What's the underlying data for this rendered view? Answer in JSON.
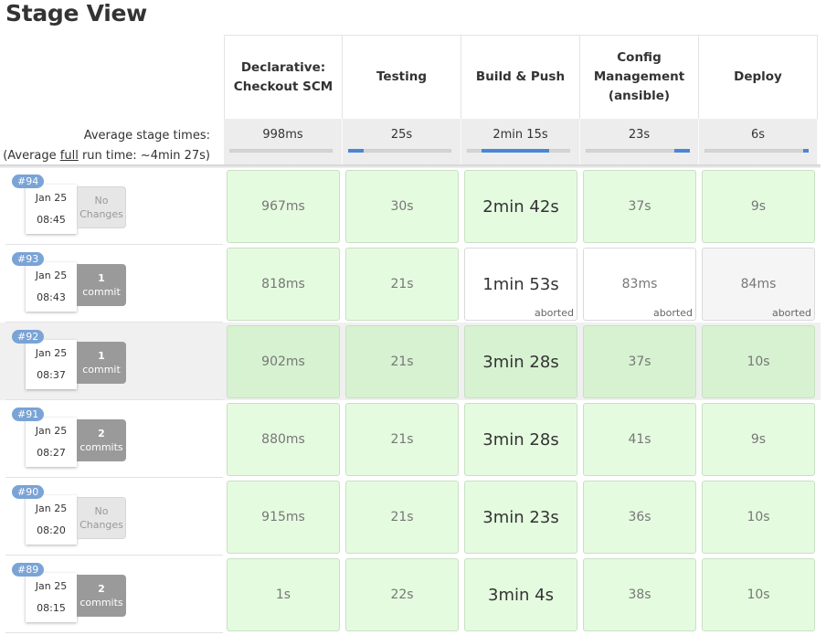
{
  "page": {
    "title": "Stage View"
  },
  "summary": {
    "avg_label": "Average stage times:",
    "full_prefix": "(Average ",
    "full_link": "full",
    "full_suffix": " run time: ~4min 27s)"
  },
  "stages": [
    {
      "name": "Declarative: Checkout SCM",
      "avg": "998ms",
      "fill": 0.0
    },
    {
      "name": "Testing",
      "avg": "25s",
      "fill": 0.15
    },
    {
      "name": "Build & Push",
      "avg": "2min 15s",
      "fill": 0.65
    },
    {
      "name": "Config Management (ansible)",
      "avg": "23s",
      "fill": 0.15
    },
    {
      "name": "Deploy",
      "avg": "6s",
      "fill": 0.05
    }
  ],
  "runs": [
    {
      "id": "#94",
      "date": "Jan 25",
      "time": "08:45",
      "changes_n": "No",
      "changes_w": "Changes",
      "has_changes": false,
      "cells": [
        {
          "v": "967ms"
        },
        {
          "v": "30s"
        },
        {
          "v": "2min 42s"
        },
        {
          "v": "37s"
        },
        {
          "v": "9s"
        }
      ]
    },
    {
      "id": "#93",
      "date": "Jan 25",
      "time": "08:43",
      "changes_n": "1",
      "changes_w": "commit",
      "has_changes": true,
      "cells": [
        {
          "v": "818ms"
        },
        {
          "v": "21s"
        },
        {
          "v": "1min 53s",
          "status": "aborted"
        },
        {
          "v": "83ms",
          "status": "aborted"
        },
        {
          "v": "84ms",
          "status": "aborted"
        }
      ]
    },
    {
      "id": "#92",
      "date": "Jan 25",
      "time": "08:37",
      "changes_n": "1",
      "changes_w": "commit",
      "has_changes": true,
      "cells": [
        {
          "v": "902ms"
        },
        {
          "v": "21s"
        },
        {
          "v": "3min 28s"
        },
        {
          "v": "37s"
        },
        {
          "v": "10s"
        }
      ]
    },
    {
      "id": "#91",
      "date": "Jan 25",
      "time": "08:27",
      "changes_n": "2",
      "changes_w": "commits",
      "has_changes": true,
      "cells": [
        {
          "v": "880ms"
        },
        {
          "v": "21s"
        },
        {
          "v": "3min 28s"
        },
        {
          "v": "41s"
        },
        {
          "v": "9s"
        }
      ]
    },
    {
      "id": "#90",
      "date": "Jan 25",
      "time": "08:20",
      "changes_n": "No",
      "changes_w": "Changes",
      "has_changes": false,
      "cells": [
        {
          "v": "915ms"
        },
        {
          "v": "21s"
        },
        {
          "v": "3min 23s"
        },
        {
          "v": "36s"
        },
        {
          "v": "10s"
        }
      ]
    },
    {
      "id": "#89",
      "date": "Jan 25",
      "time": "08:15",
      "changes_n": "2",
      "changes_w": "commits",
      "has_changes": true,
      "cells": [
        {
          "v": "1s"
        },
        {
          "v": "22s"
        },
        {
          "v": "3min 4s"
        },
        {
          "v": "38s"
        },
        {
          "v": "10s"
        }
      ]
    }
  ]
}
